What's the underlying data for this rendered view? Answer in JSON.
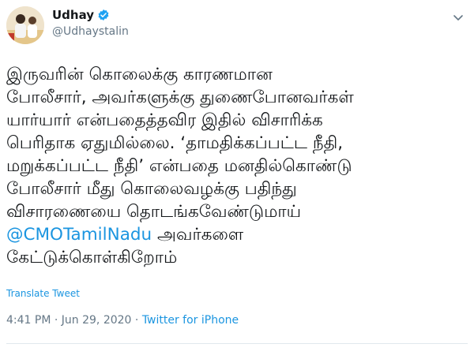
{
  "tweet": {
    "author": {
      "name": "Udhay",
      "handle": "@Udhaystalin",
      "verified": true
    },
    "body_lines": [
      "இருவரின் கொலைக்கு காரணமான",
      "போலீசார், அவர்களுக்கு துணைபோனவர்கள்",
      "யார்யார் என்பதைத்தவிர இதில் விசாரிக்க",
      "பெரிதாக ஏதுமில்லை. ‘தாமதிக்கப்பட்ட நீதி,",
      "மறுக்கப்பட்ட நீதி’ என்பதை மனதில்கொண்டு",
      "போலீசார் மீது கொலைவழக்கு பதிந்து",
      "விசாரணையை தொடங்கவேண்டுமாய்"
    ],
    "mention": "@CMOTamilNadu",
    "mention_rest": " அவர்களை",
    "last_line": "கேட்டுக்கொள்கிறோம்",
    "translate_label": "Translate Tweet",
    "time": "4:41 PM",
    "separator": " · ",
    "date": "Jun 29, 2020",
    "source": "Twitter for iPhone"
  },
  "colors": {
    "link": "#1b95e0",
    "secondary": "#657786",
    "verified": "#1da1f2",
    "divider": "#e1e8ed"
  },
  "icons": {
    "verified": "verified-badge-icon",
    "menu": "chevron-down-icon"
  }
}
